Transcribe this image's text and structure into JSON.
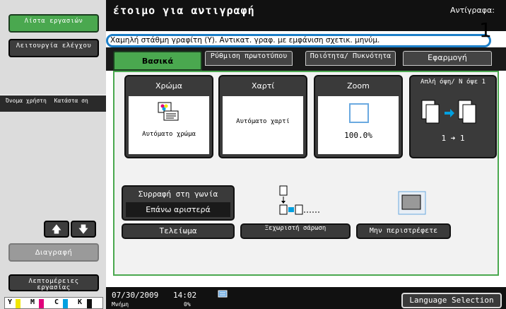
{
  "header": {
    "title": "έτοιμο για αντιγραφή",
    "copies_label": "Αντίγραφα:",
    "message": "Χαμηλή στάθμη γραφίτη (Y). Αντικατ. γραφ. με εμφάνιση σχετικ. μηνύμ.",
    "callout_number": "1"
  },
  "left_panel": {
    "job_list_label": "Λίστα εργασιών",
    "utility_label": "Λειτουργία ελέγχου",
    "user_name_label": "Όνομα χρήστη",
    "status_label": "Κατάστα ση",
    "delete_label": "Διαγραφή",
    "details_label": "Λεπτομέρειες εργασίας",
    "toner": [
      "Y",
      "M",
      "C",
      "K"
    ]
  },
  "tabs": [
    {
      "label": "Βασικά"
    },
    {
      "label": "Ρύθμιση πρωτοτύπου"
    },
    {
      "label": "Ποιότητα/ Πυκνότητα"
    },
    {
      "label": "Εφαρμογή"
    }
  ],
  "functions": {
    "color": {
      "title": "Χρώμα",
      "value": "Αυτόματο χρώμα"
    },
    "paper": {
      "title": "Χαρτί",
      "value": "Αυτόματο χαρτί"
    },
    "zoom": {
      "title": "Zoom",
      "value": "100.0%"
    },
    "duplex": {
      "title": "Απλή όψη/ Ν όψε 1",
      "value": "1 ➜ 1"
    }
  },
  "staple": {
    "label": "Συρραφή στη γωνία",
    "value": "Επάνω αριστερά"
  },
  "buttons": {
    "finishing": "Τελείωμα",
    "separate_scan": "Ξεχωριστή σάρωση",
    "no_rotate": "Μην περιστρέφετε"
  },
  "footer": {
    "date": "07/30/2009",
    "time": "14:02",
    "memory_label": "Μνήμη",
    "memory_value": "0%",
    "language_button": "Language Selection"
  },
  "colors": {
    "accent_green": "#4aa84f",
    "message_border": "#1d7fc8",
    "toner_y": "#f2e600",
    "toner_m": "#e0007a",
    "toner_c": "#00a0e0",
    "toner_k": "#111111"
  }
}
